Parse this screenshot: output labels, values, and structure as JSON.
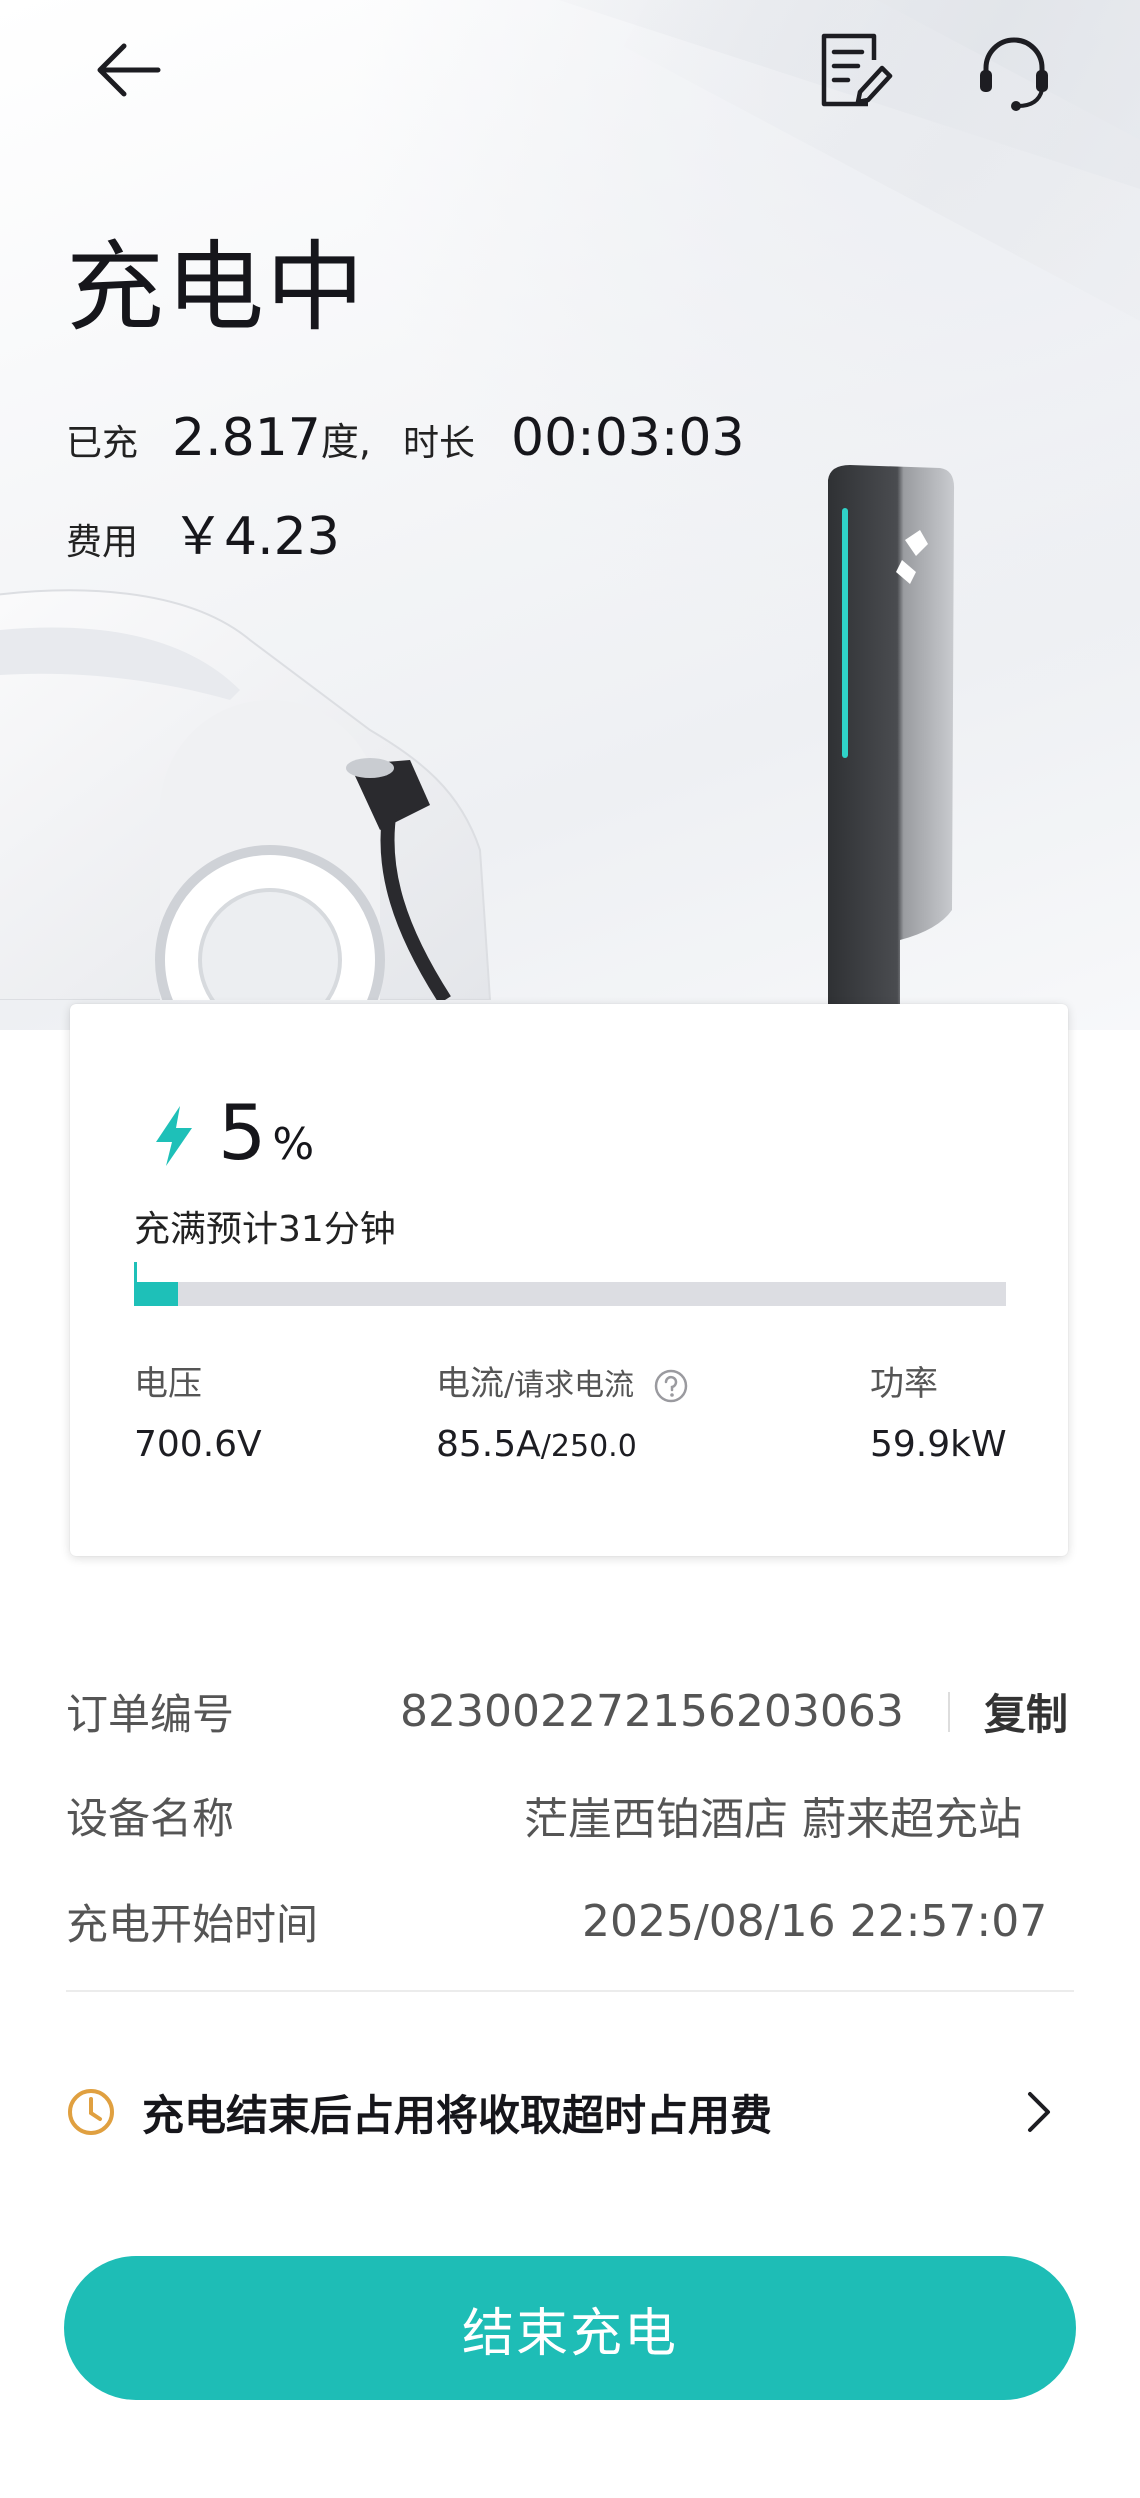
{
  "header": {
    "title": "充电中",
    "charged_label": "已充",
    "charged_value": "2.817",
    "charged_unit": "度,",
    "duration_label": "时长",
    "duration_value": "00:03:03",
    "cost_label": "费用",
    "cost_value": "￥4.23"
  },
  "status_card": {
    "battery_percent": "5",
    "percent_unit": "%",
    "battery_fraction": 0.05,
    "eta_text": "充满预计31分钟",
    "voltage_label": "电压",
    "voltage_value": "700.6V",
    "current_label": "电流",
    "current_request_label": "/请求电流",
    "current_value": "85.5A",
    "current_request_value": "/250.0",
    "power_label": "功率",
    "power_value": "59.9kW"
  },
  "order": {
    "order_no_label": "订单编号",
    "order_no_value": "823002272156203063",
    "copy_label": "复制",
    "device_label": "设备名称",
    "device_value": "茫崖西铂酒店 蔚来超充站",
    "start_time_label": "充电开始时间",
    "start_time_value": "2025/08/16 22:57:07"
  },
  "notice": {
    "text": "充电结束后占用将收取超时占用费"
  },
  "actions": {
    "end_charging_label": "结束充电"
  },
  "colors": {
    "accent": "#1ebdb6",
    "warning": "#e0a040"
  },
  "icons": {
    "back": "back-arrow-icon",
    "document": "document-edit-icon",
    "support": "headset-icon",
    "bolt": "lightning-bolt-icon",
    "help": "question-circle-icon",
    "clock": "clock-icon",
    "chevron": "chevron-right-icon"
  }
}
